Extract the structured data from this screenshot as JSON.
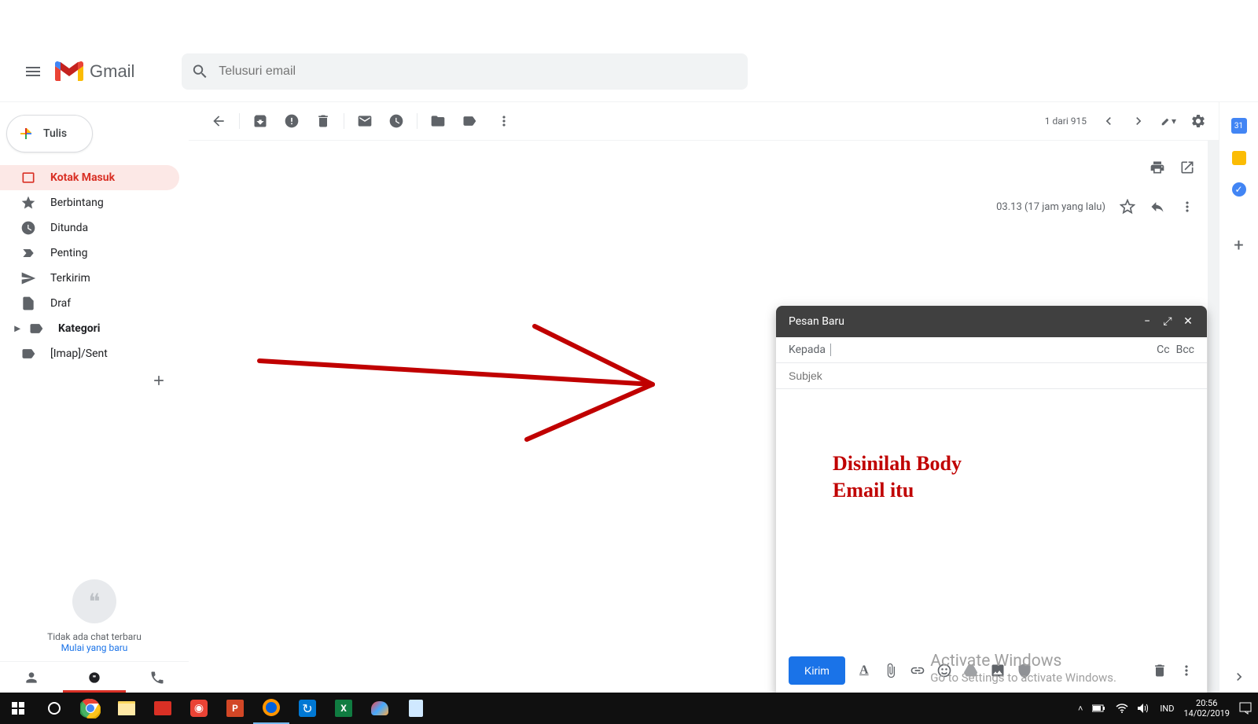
{
  "header": {
    "app_name": "Gmail",
    "search_placeholder": "Telusuri email"
  },
  "compose_button": "Tulis",
  "sidebar": {
    "items": [
      {
        "label": "Kotak Masuk"
      },
      {
        "label": "Berbintang"
      },
      {
        "label": "Ditunda"
      },
      {
        "label": "Penting"
      },
      {
        "label": "Terkirim"
      },
      {
        "label": "Draf"
      },
      {
        "label": "Kategori"
      },
      {
        "label": "[Imap]/Sent"
      }
    ],
    "hangouts_empty": "Tidak ada chat terbaru",
    "hangouts_link": "Mulai yang baru"
  },
  "toolbar": {
    "pagination": "1 dari 915"
  },
  "message": {
    "timestamp": "03.13 (17 jam yang lalu)"
  },
  "compose": {
    "title": "Pesan Baru",
    "to_label": "Kepada",
    "cc": "Cc",
    "bcc": "Bcc",
    "subject_placeholder": "Subjek",
    "body_annotation_line1": "Disinilah Body",
    "body_annotation_line2": "Email itu",
    "send": "Kirim"
  },
  "watermark": {
    "line1": "Activate Windows",
    "line2": "Go to Settings to activate Windows."
  },
  "taskbar": {
    "lang": "IND",
    "time": "20:56",
    "date": "14/02/2019"
  }
}
